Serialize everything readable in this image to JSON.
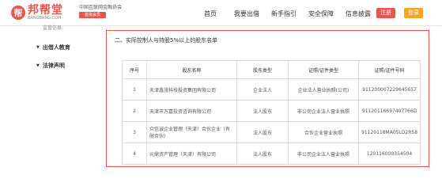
{
  "logo": {
    "mark": "帮",
    "name": "邦帮堂",
    "sub": "BANGBANG.COM"
  },
  "association": {
    "name": "中国互联网金融协会",
    "badge": "首批会员"
  },
  "nav": [
    {
      "label": "首页"
    },
    {
      "label": "我要出借"
    },
    {
      "label": "新手指引"
    },
    {
      "label": "安全保障"
    },
    {
      "label": "信息披露"
    }
  ],
  "buttons": {
    "register": "注册",
    "login": "登录"
  },
  "sidebar": {
    "top": "监管信息",
    "items": [
      {
        "label": "出借人教育"
      },
      {
        "label": "法律声明"
      }
    ]
  },
  "section": {
    "title": "二、实际控制人与持股5%以上的股东名单"
  },
  "table": {
    "headers": [
      "序号",
      "股东名称",
      "股东类型",
      "证照/证件类型",
      "证照/证件号码"
    ],
    "rows": [
      [
        "1",
        "天津鑫茂科技投资集团有限公司",
        "企业法人",
        "企业法人营业执照(公司)",
        "911200007229645657"
      ],
      [
        "2",
        "天津市万嘉投资咨询有限公司",
        "法人股东",
        "非公司企业法人营业执照",
        "91120116697407766D"
      ],
      [
        "3",
        "众信诚企业管理（天津）合伙企业（有限合伙）",
        "法人股东",
        "合伙企业营业执照",
        "91120118MA05LD2R58"
      ],
      [
        "4",
        "元鼎资产管理（天津）有限公司",
        "法人股东",
        "非公司企业法人营业执照",
        "120116000354504"
      ]
    ]
  }
}
